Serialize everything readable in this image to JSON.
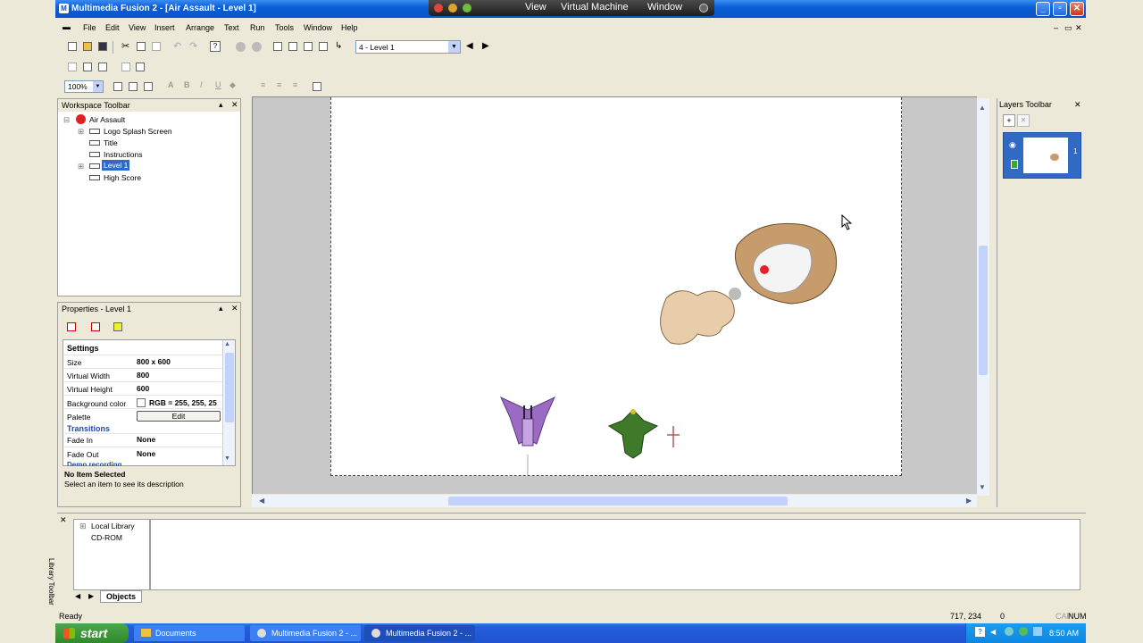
{
  "window": {
    "title": "Multimedia Fusion 2 - [Air Assault - Level 1]",
    "app_icon": "mmf-icon"
  },
  "vm_bar": {
    "items": [
      "View",
      "Virtual Machine",
      "Window"
    ]
  },
  "menu": [
    "File",
    "Edit",
    "View",
    "Insert",
    "Arrange",
    "Text",
    "Run",
    "Tools",
    "Window",
    "Help"
  ],
  "frame_select": {
    "value": "4 - Level 1"
  },
  "zoom": {
    "value": "100%"
  },
  "workspace": {
    "title": "Workspace Toolbar",
    "app": "Air Assault",
    "frames": [
      "Logo Splash Screen",
      "Title",
      "Instructions",
      "Level 1",
      "High Score"
    ],
    "selected": "Level 1"
  },
  "properties": {
    "title": "Properties - Level 1",
    "section_settings": "Settings",
    "rows": [
      {
        "label": "Size",
        "value": "800 x 600"
      },
      {
        "label": "Virtual Width",
        "value": "800"
      },
      {
        "label": "Virtual Height",
        "value": "600"
      },
      {
        "label": "Background color",
        "value": "RGB = 255, 255, 25"
      },
      {
        "label": "Palette",
        "value": "Edit"
      }
    ],
    "section_transitions": "Transitions",
    "transitions": [
      {
        "label": "Fade In",
        "value": "None"
      },
      {
        "label": "Fade Out",
        "value": "None"
      }
    ],
    "section_demo": "Demo recording",
    "desc_title": "No Item Selected",
    "desc_text": "Select an item to see its description"
  },
  "layers": {
    "title": "Layers Toolbar",
    "layer_number": "1"
  },
  "library": {
    "title": "Library Toolbar",
    "items": [
      "Local Library",
      "CD-ROM"
    ],
    "tab": "Objects"
  },
  "status": {
    "text": "Ready",
    "coords": "717, 234",
    "num": "0",
    "cap": "CAP",
    "numlock": "NUM"
  },
  "taskbar": {
    "start": "start",
    "tasks": [
      "Documents",
      "Multimedia Fusion 2 - ...",
      "Multimedia Fusion 2 - ..."
    ],
    "clock": "8:50 AM"
  },
  "colors": {
    "title_blue": "#0a52c6",
    "selection": "#316ac5",
    "start_green": "#2f8a2c"
  }
}
